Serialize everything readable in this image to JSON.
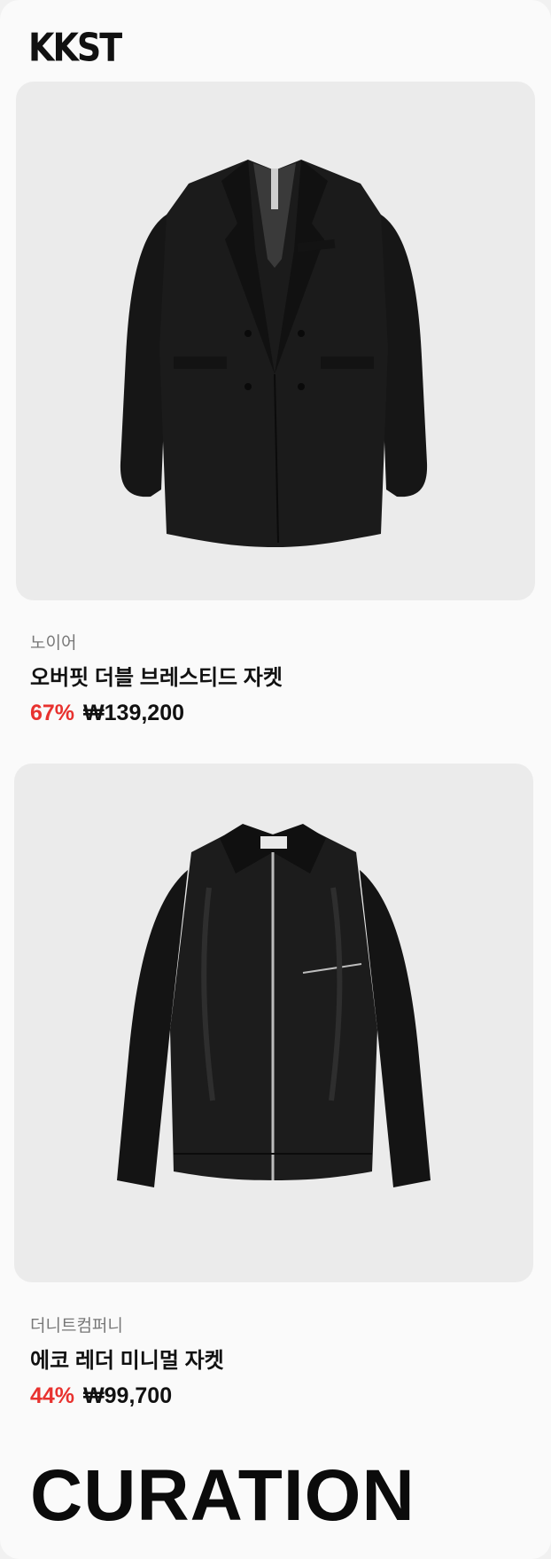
{
  "header": {
    "logo": "KKST"
  },
  "products": [
    {
      "image_icon": "double-breasted-jacket-image",
      "brand": "노이어",
      "name": "오버핏 더블 브레스티드 자켓",
      "discount": "67%",
      "price": "₩139,200"
    },
    {
      "image_icon": "leather-jacket-image",
      "brand": "더니트컴퍼니",
      "name": "에코 레더 미니멀 자켓",
      "discount": "44%",
      "price": "₩99,700"
    }
  ],
  "section": {
    "title": "CURATION"
  },
  "colors": {
    "discount": "#e8322f",
    "card_bg": "#ebebeb",
    "text": "#111111"
  }
}
